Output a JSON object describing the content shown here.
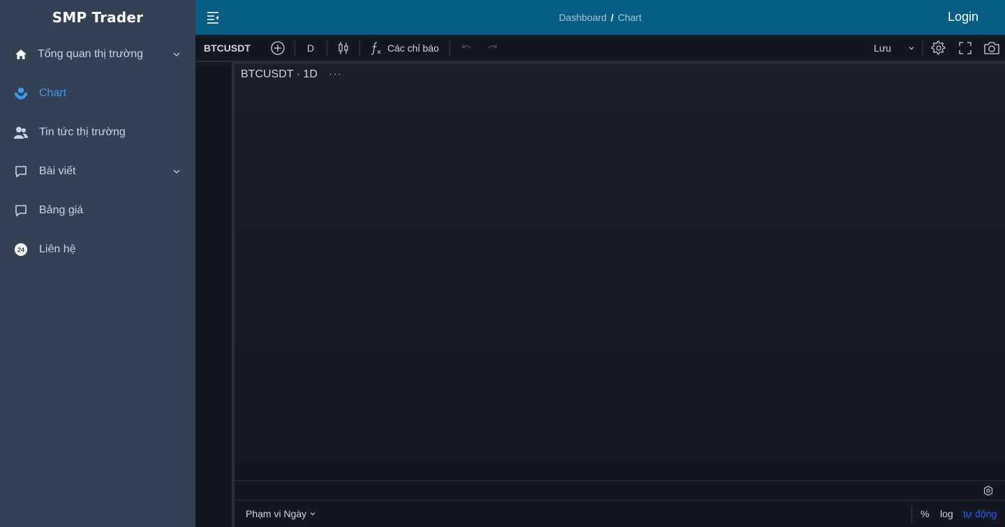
{
  "brand": "SMP Trader",
  "sidebar": {
    "items": [
      {
        "label": "Tổng quan thị trường",
        "icon": "home-icon",
        "expandable": true
      },
      {
        "label": "Chart",
        "icon": "chart-hands-icon",
        "active": true
      },
      {
        "label": "Tin tức thị trường",
        "icon": "users-icon"
      },
      {
        "label": "Bài viết",
        "icon": "comment-icon",
        "expandable": true
      },
      {
        "label": "Bảng giá",
        "icon": "comment-icon"
      },
      {
        "label": "Liên hệ",
        "icon": "support-24-icon"
      }
    ]
  },
  "header": {
    "breadcrumb": [
      "Dashboard",
      "Chart"
    ],
    "separator": "/",
    "login": "Login"
  },
  "toolbar": {
    "symbol": "BTCUSDT",
    "interval": "D",
    "indicators": "Các chỉ báo",
    "save": "Lưu"
  },
  "chart": {
    "legend": "BTCUSDT · 1D",
    "more": "···"
  },
  "bottom": {
    "range": "Phạm vi Ngày",
    "percent": "%",
    "log": "log",
    "auto": "tự động"
  },
  "colors": {
    "sidebar_bg": "#334155",
    "header_bg": "#075e84",
    "chart_bg": "#131722",
    "active": "#3b9cf5",
    "auto_link": "#2962ff"
  }
}
